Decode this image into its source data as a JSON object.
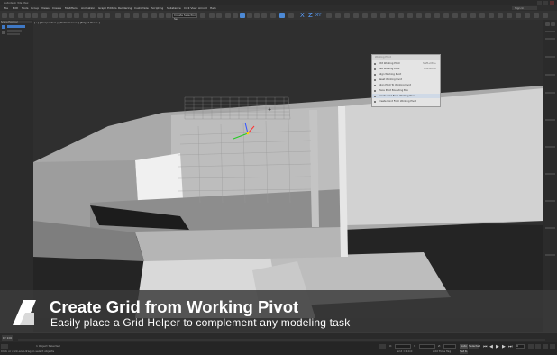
{
  "app": {
    "title": "Autodesk 3ds Max"
  },
  "menu": {
    "items": [
      "File",
      "Edit",
      "Tools",
      "Group",
      "Views",
      "Create",
      "Modifiers",
      "Animation",
      "Graph Editors",
      "Rendering",
      "Customize",
      "Scripting",
      "Substance",
      "Civil View",
      "Arnold",
      "Help"
    ],
    "sign_in": "Sign In"
  },
  "toolbar": {
    "selection_set": "Create Selection Se"
  },
  "left_panel": {
    "title": "Scene Explorer"
  },
  "viewport": {
    "label": "[+] [Perspective ] [Performance ] [Edged Faces ]"
  },
  "context_menu": {
    "header": "Working Pivot",
    "items": [
      {
        "label": "Edit Working Pivot",
        "shortcut": "Shift+Ctrl+"
      },
      {
        "label": "Use Working Pivot",
        "shortcut": "Alt+Shift+"
      },
      {
        "label": "Align Working Pivot",
        "shortcut": ""
      },
      {
        "label": "Reset Working Pivot",
        "shortcut": ""
      },
      {
        "label": "Align Pivot To Working Pivot",
        "shortcut": ""
      },
      {
        "label": "Place Pivot Bounding Box",
        "shortcut": ""
      },
      {
        "label": "Create Grid From Working Pivot",
        "shortcut": ""
      },
      {
        "label": "Create Point From Working Pivot",
        "shortcut": ""
      }
    ]
  },
  "banner": {
    "title": "Create Grid from Working Pivot",
    "subtitle": "Easily place a Grid Helper to complement any modeling task"
  },
  "timeline": {
    "frame": "0 / 100"
  },
  "status": {
    "left_text": "Click or click-and-drag to select objects",
    "selected": "1 Object Selected",
    "x": "X:",
    "y": "Y:",
    "z": "Z:",
    "grid": "Grid = 10.0",
    "add_time_tag": "Add Time Tag",
    "auto": "Auto",
    "set_key": "Set K.",
    "selected_btn": "Selected",
    "frame_field": "0"
  },
  "colors": {
    "accent": "#4d8ad6",
    "banner_bg": "#3a3a3a",
    "viewport_bg": "#2e2e2e"
  }
}
